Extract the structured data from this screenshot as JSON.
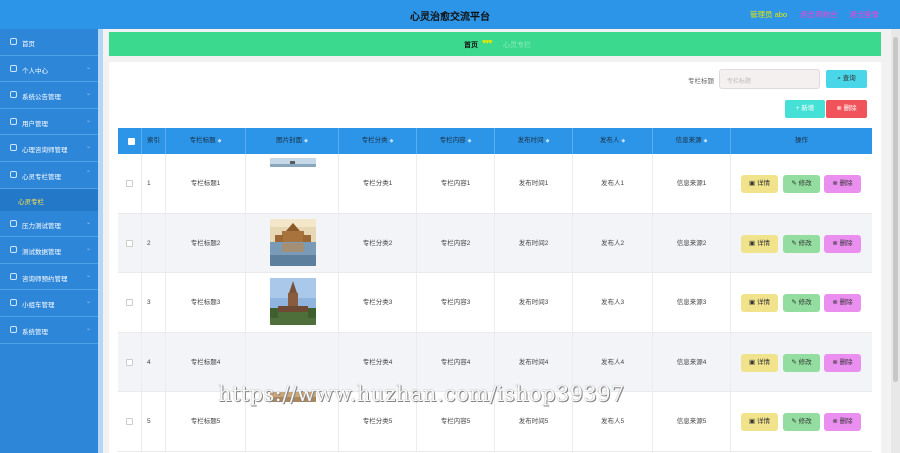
{
  "header": {
    "title": "心灵治愈交流平台",
    "admin": "管理员 abo",
    "back": "退出到前台",
    "logout": "退出登录"
  },
  "sidebar": {
    "items": [
      {
        "label": "首页",
        "icon": "home-icon"
      },
      {
        "label": "个人中心",
        "icon": "user-icon"
      },
      {
        "label": "系统公告管理",
        "icon": "notice-icon"
      },
      {
        "label": "用户管理",
        "icon": "users-icon"
      },
      {
        "label": "心理咨询师管理",
        "icon": "consultant-icon"
      },
      {
        "label": "心灵专栏管理",
        "icon": "column-icon"
      }
    ],
    "sub_item": "心灵专栏",
    "items_after": [
      {
        "label": "压力测试管理",
        "icon": "test-icon"
      },
      {
        "label": "测试数据管理",
        "icon": "data-icon"
      },
      {
        "label": "咨询师预约管理",
        "icon": "appointment-icon"
      },
      {
        "label": "小组车管理",
        "icon": "group-icon"
      },
      {
        "label": "系统管理",
        "icon": "settings-icon"
      }
    ]
  },
  "breadcrumb": {
    "home": "首页",
    "sep": "♥♥♥",
    "current": "心灵专栏"
  },
  "search": {
    "label": "专栏标题",
    "placeholder": "专栏标题",
    "query_btn": "查询"
  },
  "actions": {
    "add": "新增",
    "delete": "删除"
  },
  "table": {
    "headers": [
      "索引",
      "专栏标题",
      "图片封面",
      "专栏分类",
      "专栏内容",
      "发布时间",
      "发布人",
      "信息来源",
      "操作"
    ],
    "rows": [
      {
        "index": "1",
        "title": "专栏标题1",
        "category": "专栏分类1",
        "content": "专栏内容1",
        "time": "发布时间1",
        "publisher": "发布人1",
        "source": "信息来源1",
        "image": "boat"
      },
      {
        "index": "2",
        "title": "专栏标题2",
        "category": "专栏分类2",
        "content": "专栏内容2",
        "time": "发布时间2",
        "publisher": "发布人2",
        "source": "信息来源2",
        "image": "palace"
      },
      {
        "index": "3",
        "title": "专栏标题3",
        "category": "专栏分类3",
        "content": "专栏内容3",
        "time": "发布时间3",
        "publisher": "发布人3",
        "source": "信息来源3",
        "image": "statue"
      },
      {
        "index": "4",
        "title": "专栏标题4",
        "category": "专栏分类4",
        "content": "专栏内容4",
        "time": "发布时间4",
        "publisher": "发布人4",
        "source": "信息来源4",
        "image": "none"
      },
      {
        "index": "5",
        "title": "专栏标题5",
        "category": "专栏分类5",
        "content": "专栏内容5",
        "time": "发布时间5",
        "publisher": "发布人5",
        "source": "信息来源5",
        "image": "partial"
      }
    ],
    "row_actions": {
      "detail": "详情",
      "edit": "修改",
      "delete": "删除"
    }
  },
  "watermark": "https://www.huzhan.com/ishop39397",
  "colors": {
    "header": "#2d95e7",
    "sidebar": "#2d86d8",
    "breadcrumb": "#3bd98e",
    "accent_pink": "#ff3bd0"
  }
}
